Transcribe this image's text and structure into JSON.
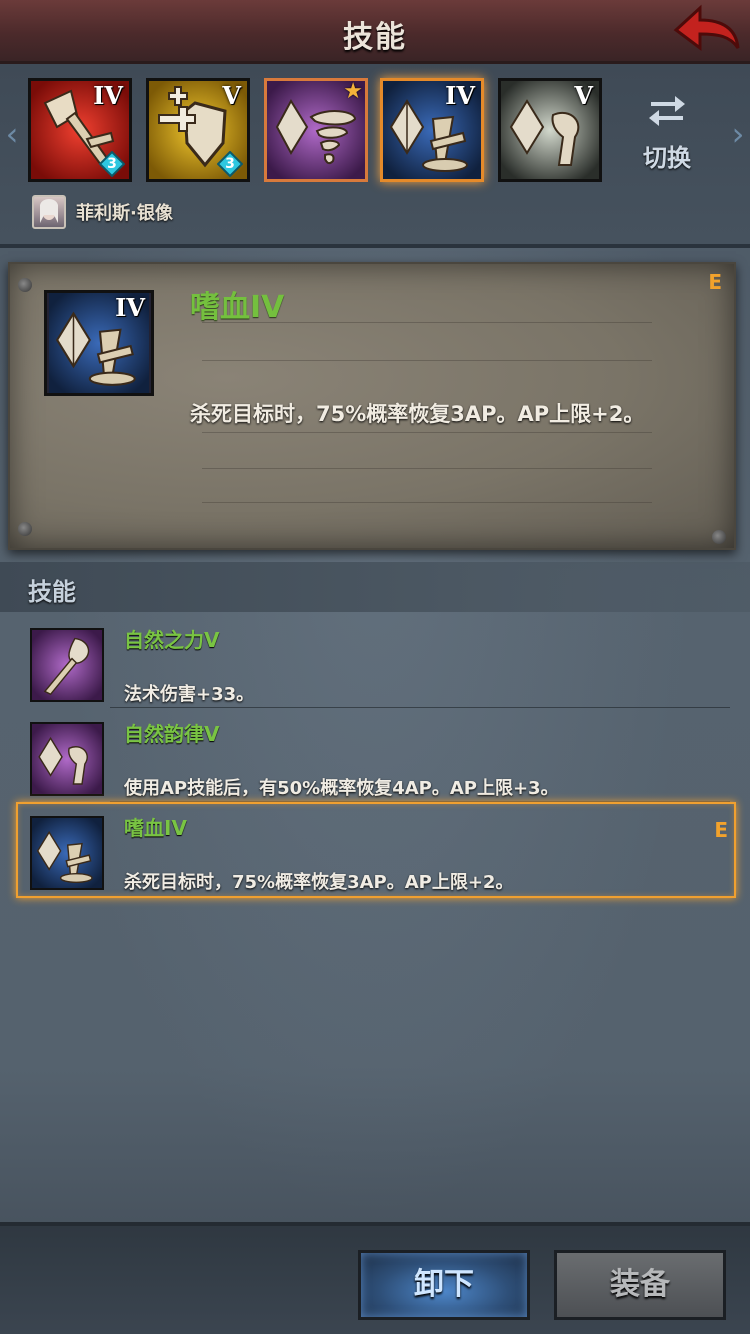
{
  "header": {
    "title": "技能"
  },
  "skill_bar": {
    "slots": [
      {
        "roman": "IV",
        "gem": "3"
      },
      {
        "roman": "V",
        "gem": "3"
      },
      {
        "roman": "",
        "star": "★"
      },
      {
        "roman": "IV"
      },
      {
        "roman": "V"
      }
    ],
    "switch_label": "切换",
    "hero_name": "菲利斯·银像"
  },
  "detail": {
    "name": "嗜血IV",
    "roman": "IV",
    "badge": "E",
    "description": "杀死目标时，75%概率恢复3AP。AP上限+2。"
  },
  "section": {
    "title": "技能"
  },
  "skills": [
    {
      "name": "自然之力V",
      "description": "法术伤害+33。"
    },
    {
      "name": "自然韵律V",
      "description": "使用AP技能后，有50%概率恢复4AP。AP上限+3。"
    },
    {
      "name": "嗜血IV",
      "description": "杀死目标时，75%概率恢复3AP。AP上限+2。",
      "badge": "E"
    }
  ],
  "footer": {
    "unequip_label": "卸下",
    "equip_label": "装备"
  },
  "colors": {
    "skill_name": "#74c03e",
    "accent": "#f0a030",
    "header": "#4c2a2b"
  }
}
